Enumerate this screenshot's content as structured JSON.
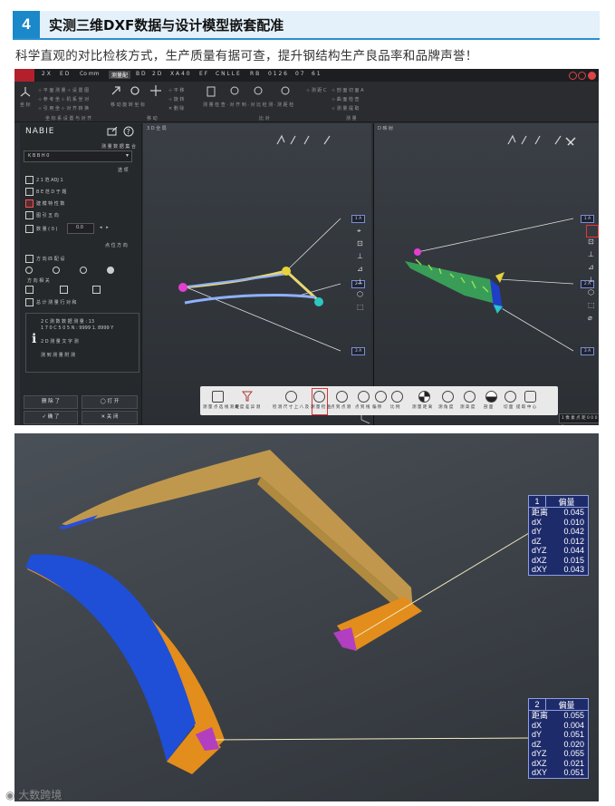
{
  "section": {
    "number": "4",
    "title": "实测三维DXF数据与设计模型嵌套配准"
  },
  "subtitle": "科学直观的对比检核方式，生产质量有据可查，提升钢结构生产良品率和品牌声誉！",
  "app": {
    "panel_title": "NABIE",
    "dropdown_value": "K B B H 0",
    "checkbox_labels": [
      "2 1 范 ADJ 1",
      "B E 范 D 于 题",
      "建 模 特 性 数",
      "图 引 五 向"
    ],
    "btn_cancel": "删 除 了",
    "btn_open": "◯ 打 开",
    "btn_confirm": "✓ 确 了",
    "btn_close": "✕ 关 闭",
    "info_lines": [
      "2 C 测 数 数 据 测 量 : 13",
      "1 7 0 C 5 0 5 N : 9999 1. 8999 Y",
      "2 D 测 量 文 字 测",
      "测 到 测 量 附 测"
    ],
    "viewport_left_label": "3 D 全 局",
    "viewport_right_label": "D 映 射",
    "tags_left": [
      "1 A",
      "2 A",
      "3 A"
    ],
    "tags_right": [
      "1 A",
      "2 A",
      "3 A"
    ],
    "status_text": "1 像 素 点 距 0 0 0 ▾",
    "toolbar_labels": [
      "测 量 点 选 线 测 距",
      "角 度 差 异 测",
      "检 测 尺 寸 上 八 及",
      "测 量 检 查",
      "点 到 点 测",
      "点 到 线",
      "偏 移",
      "比 例",
      "测 量 距 离",
      "测 角 度",
      "测 高 度",
      "剖 面",
      "切 面",
      "提 取 中 心"
    ]
  },
  "deviation_cards": [
    {
      "number": "1",
      "title": "偏量",
      "rows": [
        [
          "距离",
          "0.045"
        ],
        [
          "dX",
          "0.010"
        ],
        [
          "dY",
          "0.042"
        ],
        [
          "dZ",
          "0.012"
        ],
        [
          "dYZ",
          "0.044"
        ],
        [
          "dXZ",
          "0.015"
        ],
        [
          "dXY",
          "0.043"
        ]
      ]
    },
    {
      "number": "2",
      "title": "偏量",
      "rows": [
        [
          "距离",
          "0.055"
        ],
        [
          "dX",
          "0.004"
        ],
        [
          "dY",
          "0.051"
        ],
        [
          "dZ",
          "0.020"
        ],
        [
          "dYZ",
          "0.055"
        ],
        [
          "dXZ",
          "0.021"
        ],
        [
          "dXY",
          "0.051"
        ]
      ]
    }
  ],
  "watermark": "大数跨境",
  "colors": {
    "accent": "#1b88c9",
    "card_bg": "#1e2b6a",
    "model_blue": "#1f4fd6",
    "model_orange": "#e08a1e",
    "model_tan": "#c9a04e"
  }
}
